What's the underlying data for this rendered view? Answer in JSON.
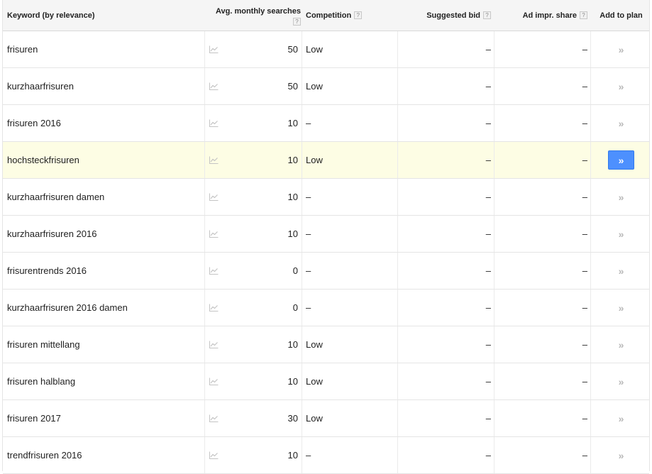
{
  "header": {
    "keyword": "Keyword (by relevance)",
    "avg_searches": "Avg. monthly searches",
    "competition": "Competition",
    "suggested_bid": "Suggested bid",
    "ad_impr_share": "Ad impr. share",
    "add_to_plan": "Add to plan",
    "help_glyph": "?"
  },
  "add_glyph": "»",
  "rows": [
    {
      "keyword": "frisuren",
      "avg": "50",
      "competition": "Low",
      "bid": "–",
      "share": "–"
    },
    {
      "keyword": "kurzhaarfrisuren",
      "avg": "50",
      "competition": "Low",
      "bid": "–",
      "share": "–"
    },
    {
      "keyword": "frisuren 2016",
      "avg": "10",
      "competition": "–",
      "bid": "–",
      "share": "–"
    },
    {
      "keyword": "hochsteckfrisuren",
      "avg": "10",
      "competition": "Low",
      "bid": "–",
      "share": "–"
    },
    {
      "keyword": "kurzhaarfrisuren damen",
      "avg": "10",
      "competition": "–",
      "bid": "–",
      "share": "–"
    },
    {
      "keyword": "kurzhaarfrisuren 2016",
      "avg": "10",
      "competition": "–",
      "bid": "–",
      "share": "–"
    },
    {
      "keyword": "frisurentrends 2016",
      "avg": "0",
      "competition": "–",
      "bid": "–",
      "share": "–"
    },
    {
      "keyword": "kurzhaarfrisuren 2016 damen",
      "avg": "0",
      "competition": "–",
      "bid": "–",
      "share": "–"
    },
    {
      "keyword": "frisuren mittellang",
      "avg": "10",
      "competition": "Low",
      "bid": "–",
      "share": "–"
    },
    {
      "keyword": "frisuren halblang",
      "avg": "10",
      "competition": "Low",
      "bid": "–",
      "share": "–"
    },
    {
      "keyword": "frisuren 2017",
      "avg": "30",
      "competition": "Low",
      "bid": "–",
      "share": "–"
    },
    {
      "keyword": "trendfrisuren 2016",
      "avg": "10",
      "competition": "–",
      "bid": "–",
      "share": "–"
    }
  ],
  "highlighted_row": 3,
  "colors": {
    "accent": "#4d90fe",
    "highlight": "#fdfde4"
  }
}
